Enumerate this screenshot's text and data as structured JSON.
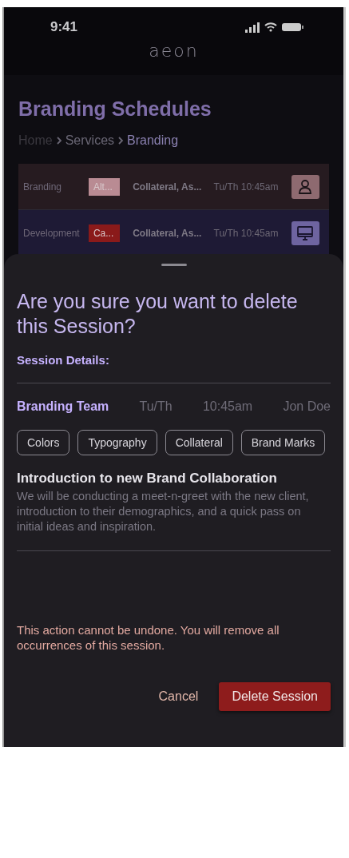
{
  "status_bar": {
    "time": "9:41"
  },
  "logo": "aeon",
  "page": {
    "title": "Branding Schedules",
    "breadcrumb": [
      {
        "label": "Home",
        "selected": false
      },
      {
        "label": "Services",
        "selected": false
      },
      {
        "label": "Branding",
        "selected": true
      }
    ]
  },
  "schedule_rows": [
    {
      "kind": "in_person",
      "name": "Branding",
      "tag": "Alt...",
      "color": "#b98b93",
      "topics": "Collateral, As...",
      "time": "Tu/Th 10:45am"
    },
    {
      "kind": "remote",
      "name": "Development",
      "tag": "Ca...",
      "color": "#8a1a1a",
      "topics": "Collateral, As...",
      "time": "Tu/Th 10:45am"
    }
  ],
  "sheet": {
    "title": "Are you sure you want to delete this Session?",
    "details_label": "Session Details:",
    "session": {
      "team": "Branding Team",
      "days": "Tu/Th",
      "time": "10:45am",
      "owner": "Jon Doe"
    },
    "tags": [
      "Colors",
      "Typography",
      "Collateral",
      "Brand Marks"
    ],
    "heading": "Introduction to new Brand Collaboration",
    "description": "We will be conducting a meet-n-greet with the new client, introduction to their demographics, and a quick pass on initial ideas and inspiration.",
    "warning": "This action cannot be undone. You will remove all occurrences of this session.",
    "buttons": {
      "cancel": "Cancel",
      "confirm": "Delete Session"
    }
  }
}
